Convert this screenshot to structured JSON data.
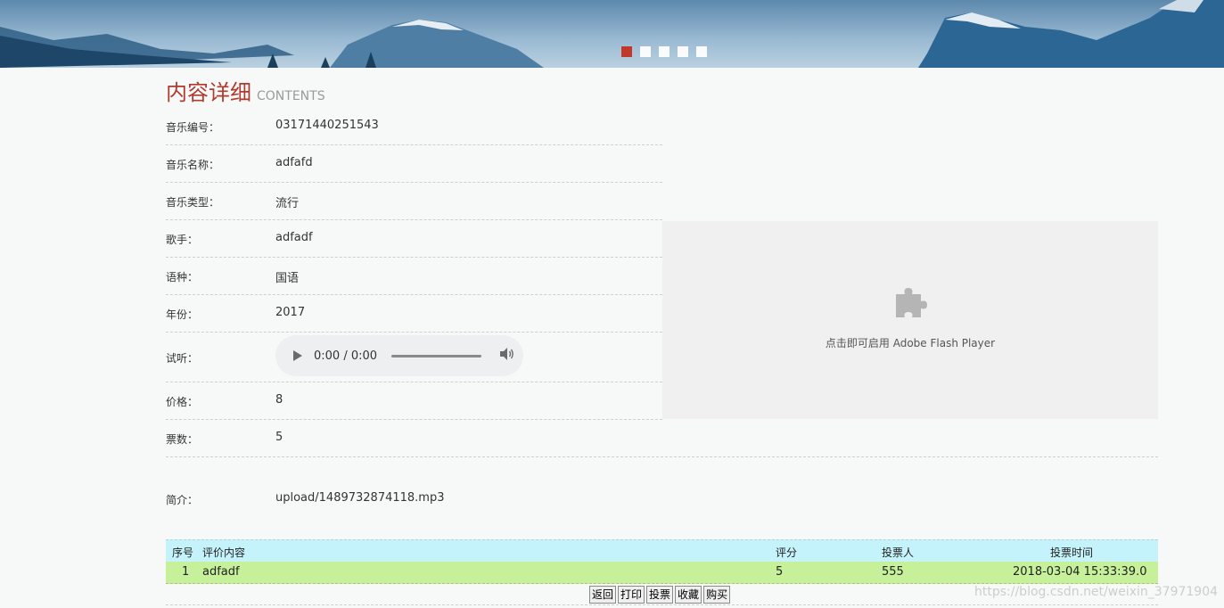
{
  "banner": {
    "slides": 5,
    "active_slide": 1,
    "colors": {
      "sky": "#8fb3cf",
      "mountain": "#1f5a88",
      "active_dot": "#c0392b"
    }
  },
  "heading": {
    "title_cn": "内容详细",
    "title_en": "CONTENTS"
  },
  "details": [
    {
      "label": "音乐编号：",
      "value": "03171440251543"
    },
    {
      "label": "音乐名称：",
      "value": "adfafd"
    },
    {
      "label": "音乐类型：",
      "value": "流行"
    },
    {
      "label": "歌手：",
      "value": "adfadf"
    },
    {
      "label": "语种：",
      "value": "国语"
    },
    {
      "label": "年份：",
      "value": "2017"
    },
    {
      "label": "试听：",
      "value": ""
    },
    {
      "label": "价格：",
      "value": "8"
    },
    {
      "label": "票数：",
      "value": "5"
    }
  ],
  "audio": {
    "time": "0:00 / 0:00",
    "play_icon": "play-icon",
    "volume_icon": "volume-icon"
  },
  "flash": {
    "text": "点击即可启用 Adobe Flash Player",
    "icon": "puzzle-icon"
  },
  "intro": {
    "label": "简介：",
    "value": "upload/1489732874118.mp3"
  },
  "comments": {
    "headers": {
      "index": "序号",
      "content": "评价内容",
      "score": "评分",
      "voter": "投票人",
      "time": "投票时间"
    },
    "rows": [
      {
        "index": "1",
        "content": "adfadf",
        "score": "5",
        "voter": "555",
        "time": "2018-03-04 15:33:39.0"
      }
    ]
  },
  "buttons": [
    "返回",
    "打印",
    "投票",
    "收藏",
    "购买"
  ],
  "watermark": "https://blog.csdn.net/weixin_37971904"
}
